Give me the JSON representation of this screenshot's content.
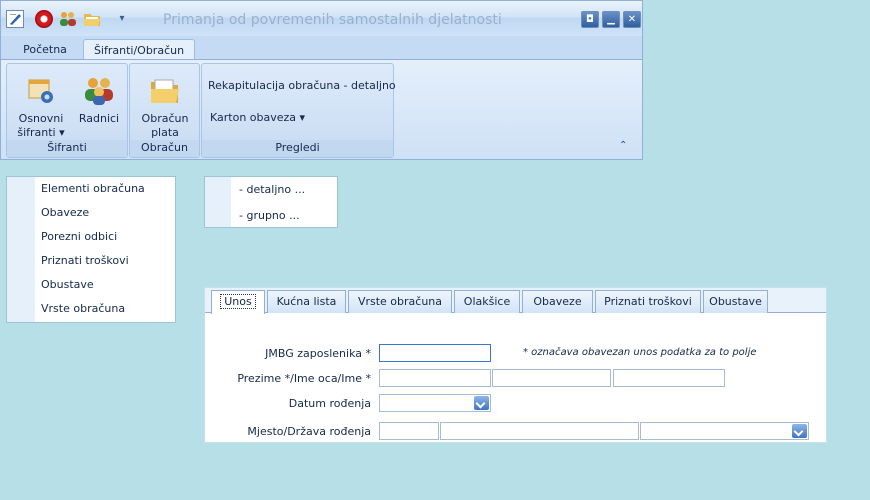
{
  "window": {
    "title": "Primanja od povremenih samostalnih djelatnosti",
    "quick_access_dropdown": "▾",
    "buttons": {
      "restore": "◘",
      "minimize": "▁",
      "close": "✕"
    }
  },
  "ribbon": {
    "tabs": [
      {
        "label": "Početna",
        "active": false
      },
      {
        "label": "Šifranti/Obračun",
        "active": true
      }
    ],
    "groups": {
      "sifranti": {
        "label": "Šifranti",
        "buttons": [
          {
            "label_line1": "Osnovni",
            "label_line2": "šifranti ▾",
            "icon": "settings-window-icon"
          },
          {
            "label_line1": "Radnici",
            "label_line2": "",
            "icon": "users-icon"
          }
        ]
      },
      "obracun": {
        "label": "Obračun",
        "buttons": [
          {
            "label_line1": "Obračun",
            "label_line2": "plata",
            "icon": "folder-open-icon"
          }
        ]
      },
      "pregledi": {
        "label": "Pregledi",
        "items": [
          "Rekapitulacija obračuna - detaljno",
          "Karton obaveza  ▾"
        ]
      }
    },
    "collapse_glyph": "⌃"
  },
  "left_panel": {
    "items": [
      "Elementi obračuna",
      "Obaveze",
      "Porezni odbici",
      "Priznati troškovi",
      "Obustave",
      "Vrste obračuna"
    ]
  },
  "sub_panel": {
    "items": [
      "- detaljno ...",
      "- grupno ..."
    ]
  },
  "form": {
    "tabs": [
      {
        "label": "Unos",
        "active": true
      },
      {
        "label": "Kućna lista",
        "active": false
      },
      {
        "label": "Vrste obračuna",
        "active": false
      },
      {
        "label": "Olakšice",
        "active": false
      },
      {
        "label": "Obaveze",
        "active": false
      },
      {
        "label": "Priznati troškovi",
        "active": false
      },
      {
        "label": "Obustave",
        "active": false
      }
    ],
    "note": "* označava obavezan unos podatka za to polje",
    "fields": {
      "jmbg_label": "JMBG zaposlenika *",
      "jmbg_value": "",
      "name_label": "Prezime */Ime oca/Ime *",
      "surname_value": "",
      "father_name_value": "",
      "first_name_value": "",
      "birth_date_label": "Datum rođenja",
      "birth_date_value": "",
      "birth_place_label": "Mjesto/Država rođenja",
      "birth_code_value": "",
      "birth_place_value": "",
      "birth_country_value": ""
    }
  },
  "colors": {
    "background": "#b7dfe8",
    "ribbon": "#d2e4f7",
    "accent": "#3f74c2"
  }
}
